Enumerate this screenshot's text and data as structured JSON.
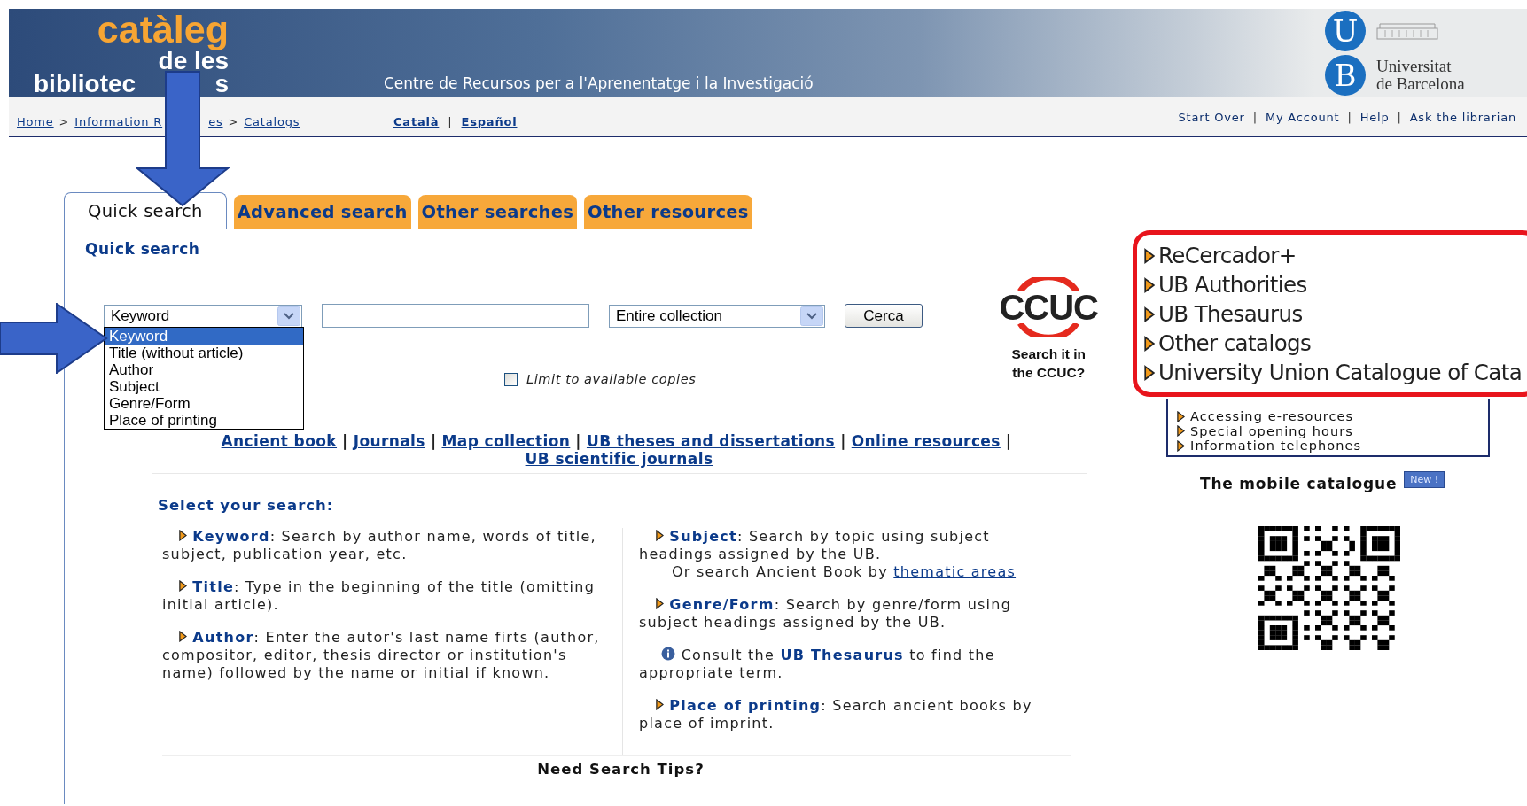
{
  "banner": {
    "logo": {
      "top": "catàleg",
      "middle": "de les",
      "bottom_left": "bibliotec",
      "bottom_right": "s"
    },
    "subtitle": "Centre de Recursos per a l'Aprenentatge i la Investigació",
    "university_letters": [
      "U",
      "B"
    ],
    "university_name": [
      "Universitat",
      "de Barcelona"
    ]
  },
  "breadcrumb": {
    "before_arrow": [
      {
        "kind": "link",
        "text": "Home"
      },
      {
        "kind": "sep",
        "text": ">"
      },
      {
        "kind": "link",
        "text": "Information R"
      }
    ],
    "after_arrow": [
      {
        "kind": "link",
        "text": "es"
      },
      {
        "kind": "sep",
        "text": ">"
      },
      {
        "kind": "link",
        "text": "Catalogs"
      }
    ]
  },
  "languages": {
    "items": [
      "Català",
      "Español"
    ],
    "separator": "|"
  },
  "top_links": {
    "items": [
      "Start Over",
      "My Account",
      "Help",
      "Ask the librarian"
    ],
    "separator": "|"
  },
  "tabs": [
    {
      "label": "Quick search",
      "selected": true
    },
    {
      "label": "Advanced search",
      "selected": false
    },
    {
      "label": "Other searches",
      "selected": false
    },
    {
      "label": "Other resources",
      "selected": false
    }
  ],
  "search": {
    "heading": "Quick search",
    "index_select": {
      "value": "Keyword",
      "expanded": true,
      "options": [
        {
          "label": "Keyword",
          "selected": true
        },
        {
          "label": "Title (without article)",
          "selected": false
        },
        {
          "label": "Author",
          "selected": false
        },
        {
          "label": "Subject",
          "selected": false
        },
        {
          "label": "Genre/Form",
          "selected": false
        },
        {
          "label": "Place of printing",
          "selected": false
        }
      ]
    },
    "scope_select": {
      "value": "Entire collection"
    },
    "button": "Cerca",
    "limit": {
      "label": "Limit to available copies",
      "checked": false
    },
    "ccuc": {
      "logo": "CCUC",
      "caption": "Search it in the CCUC?"
    }
  },
  "collection_links": {
    "items": [
      "Ancient book",
      "Journals",
      "Map collection",
      "UB theses and dissertations",
      "Online resources",
      "UB scientific journals"
    ],
    "separator": "|"
  },
  "select_heading": "Select your search:",
  "search_types": {
    "left": [
      {
        "kind": "type",
        "term": "Keyword",
        "text": ": Search by author name, words of title, subject, publication year, etc."
      },
      {
        "kind": "type",
        "term": "Title",
        "text": ": Type in the beginning of the title (omitting initial article)."
      },
      {
        "kind": "type",
        "term": "Author",
        "text": ": Enter the autor's last name firts (author, compositor, editor, thesis director or institution's name) followed by the name or initial if known."
      }
    ],
    "right": [
      {
        "kind": "type",
        "term": "Subject",
        "text": ": Search by topic using subject headings assigned by the UB.",
        "extra": "Or search  Ancient Book by",
        "extra_link": "thematic areas"
      },
      {
        "kind": "type",
        "term": "Genre/Form",
        "text": ": Search by genre/form using subject headings assigned by the UB."
      },
      {
        "kind": "note",
        "text": "Consult the **UB Thesaurus** to find the appropriate term."
      },
      {
        "kind": "type",
        "term": "Place of printing",
        "text": ": Search ancient books by place of imprint."
      }
    ]
  },
  "tips": "Need Search Tips?",
  "featured": [
    "ReCercador+",
    "UB Authorities",
    "UB Thesaurus",
    "Other catalogs",
    "University Union Catalogue of Cata"
  ],
  "info_links": [
    "Accessing e-resources",
    "Special opening hours",
    "Information telephones"
  ],
  "mobile": {
    "label": "The mobile catalogue",
    "badge": "New !"
  }
}
